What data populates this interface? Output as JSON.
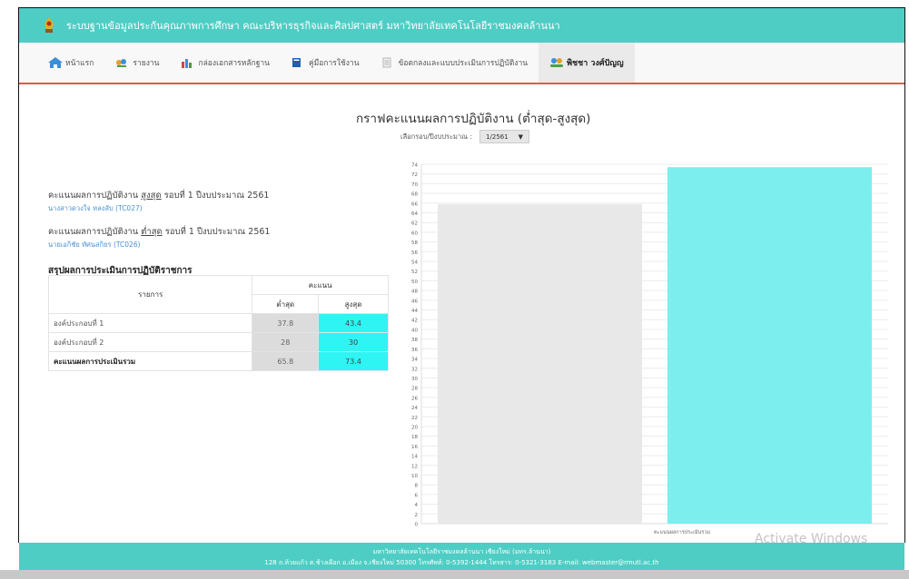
{
  "header": {
    "title": "ระบบฐานข้อมูลประกันคุณภาพการศึกษา คณะบริหารธุรกิจและศิลปศาสตร์ มหาวิทยาลัยเทคโนโลยีราชมงคลล้านนา"
  },
  "nav": [
    {
      "label": "หน้าแรก",
      "icon": "home-icon"
    },
    {
      "label": "รายงาน",
      "icon": "report-icon"
    },
    {
      "label": "กล่องเอกสารหลักฐาน",
      "icon": "chart-bar-icon"
    },
    {
      "label": "คู่มือการใช้งาน",
      "icon": "book-icon"
    },
    {
      "label": "ข้อตกลงและแบบประเมินการปฏิบัติงาน",
      "icon": "document-icon"
    },
    {
      "label": "พิชชา วงศ์ปัญญ",
      "icon": "users-icon"
    }
  ],
  "main": {
    "heading": "กราฟคะแนนผลการปฏิบัติงาน (ต่ำสุด-สูงสุด)",
    "round_label": "เลือกรอบ/ปีงบประมาณ :",
    "round_value": "1/2561",
    "round_caret": "▼",
    "max_line_prefix": "คะแนนผลการปฏิบัติงาน ",
    "max_word": "สูงสุด",
    "max_line_suffix": " รอบที่ 1 ปีงบประมาณ 2561",
    "max_name": "นางสาวดวงใจ หลงลับ (TC027)",
    "min_line_prefix": "คะแนนผลการปฏิบัติงาน ",
    "min_word": "ต่ำสุด",
    "min_line_suffix": " รอบที่ 1 ปีงบประมาณ 2561",
    "min_name": "นายเอกิชัย ทัศนสกิยร (TC026)",
    "summary_title": "สรุปผลการประเมินการปฏิบัติราชการ",
    "table": {
      "col_item": "รายการ",
      "col_score": "คะแนน",
      "col_min": "ต่ำสุด",
      "col_max": "สูงสุด",
      "rows": [
        {
          "item": "องค์ประกอบที่ 1",
          "min": "37.8",
          "max": "43.4"
        },
        {
          "item": "องค์ประกอบที่ 2",
          "min": "28",
          "max": "30"
        },
        {
          "item": "คะแนนผลการประเมินรวม",
          "min": "65.8",
          "max": "73.4"
        }
      ]
    }
  },
  "chart_data": {
    "type": "bar",
    "categories": [
      "คะแนนผลการประเมินรวม"
    ],
    "series": [
      {
        "values": [
          65.8
        ],
        "color": "#e8e8e8"
      },
      {
        "values": [
          73.4
        ],
        "color": "#7ceeee"
      }
    ],
    "ylim": [
      0,
      74
    ],
    "yticks": [
      0,
      2,
      4,
      6,
      8,
      10,
      12,
      14,
      16,
      18,
      20,
      22,
      24,
      26,
      28,
      30,
      32,
      34,
      36,
      38,
      40,
      42,
      44,
      46,
      48,
      50,
      52,
      54,
      56,
      58,
      60,
      62,
      64,
      66,
      68,
      70,
      72,
      74
    ],
    "grid": true
  },
  "footer": {
    "line1": "มหาวิทยาลัยเทคโนโลยีราชมงคลล้านนา เชียงใหม่ (มทร.ล้านนา)",
    "line2": "128 ถ.ห้วยแก้ว ต.ช้างเผือก อ.เมือง จ.เชียงใหม่ 50300 โทรศัพท์: 0-5392-1444 โทรสาร: 0-5321-3183 E-mail: webmaster@rmutl.ac.th"
  },
  "watermark": "Activate Windows",
  "colors": {
    "topbar": "#4ecdc4",
    "nav_underline": "#e05a4a",
    "max_cell": "#2ef4f4",
    "min_cell": "#dcdcdc"
  }
}
